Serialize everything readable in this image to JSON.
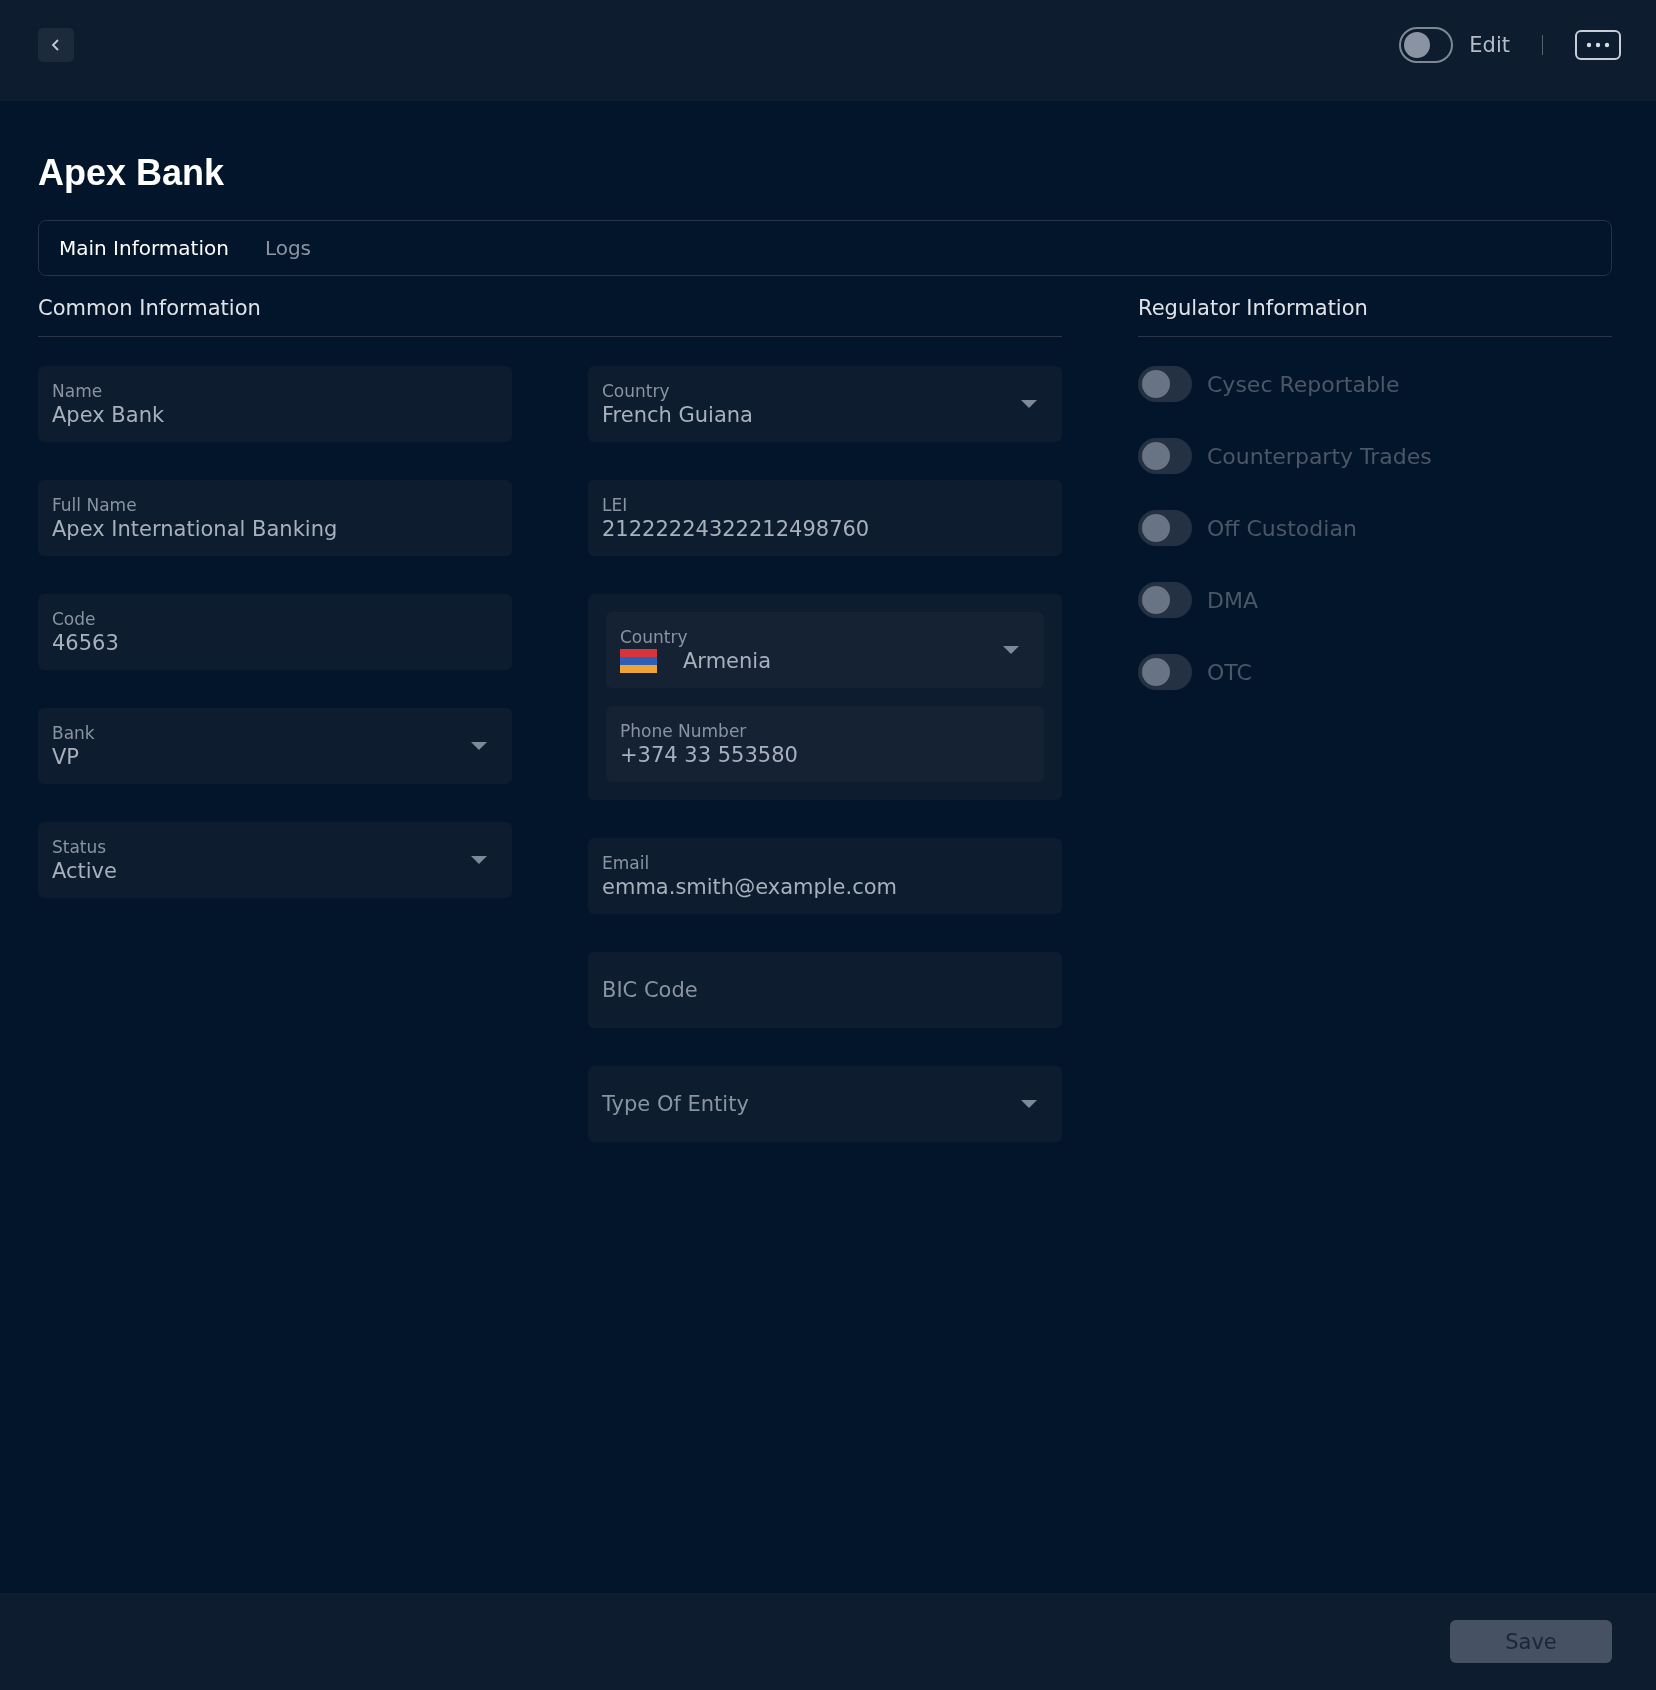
{
  "header": {
    "edit_toggle": {
      "label": "Edit",
      "on": false
    }
  },
  "title": "Apex Bank",
  "tabs": [
    {
      "label": "Main Information",
      "selected": true
    },
    {
      "label": "Logs",
      "selected": false
    }
  ],
  "common_information": {
    "heading": "Common Information",
    "column_1": [
      {
        "kind": "text",
        "label": "Name",
        "value": "Apex Bank"
      },
      {
        "kind": "text",
        "label": "Full Name",
        "value": "Apex International Banking"
      },
      {
        "kind": "text",
        "label": "Code",
        "value": "46563"
      },
      {
        "kind": "select",
        "label": "Bank",
        "value": "VP"
      },
      {
        "kind": "select",
        "label": "Status",
        "value": "Active"
      }
    ],
    "column_2": [
      {
        "kind": "select",
        "label": "Country",
        "value": "French Guiana"
      },
      {
        "kind": "text",
        "label": "LEI",
        "value": "21222224322212498760"
      },
      {
        "kind": "phone",
        "country": {
          "label": "Country",
          "value": "Armenia"
        },
        "phone": {
          "label": "Phone Number",
          "value": "+374 33 553580"
        }
      },
      {
        "kind": "text",
        "label": "Email",
        "value": "emma.smith@example.com"
      },
      {
        "kind": "text",
        "placeholder": "BIC Code"
      },
      {
        "kind": "select",
        "placeholder": "Type Of Entity"
      }
    ]
  },
  "regulator_information": {
    "heading": "Regulator Information",
    "toggles": [
      {
        "label": "Cysec Reportable",
        "on": false,
        "disabled": true
      },
      {
        "label": "Counterparty Trades",
        "on": false,
        "disabled": true
      },
      {
        "label": "Off Custodian",
        "on": false,
        "disabled": true
      },
      {
        "label": "DMA",
        "on": false,
        "disabled": true
      },
      {
        "label": "OTC",
        "on": false,
        "disabled": true
      }
    ]
  },
  "footer": {
    "save_button": {
      "label": "Save",
      "disabled": true
    }
  }
}
